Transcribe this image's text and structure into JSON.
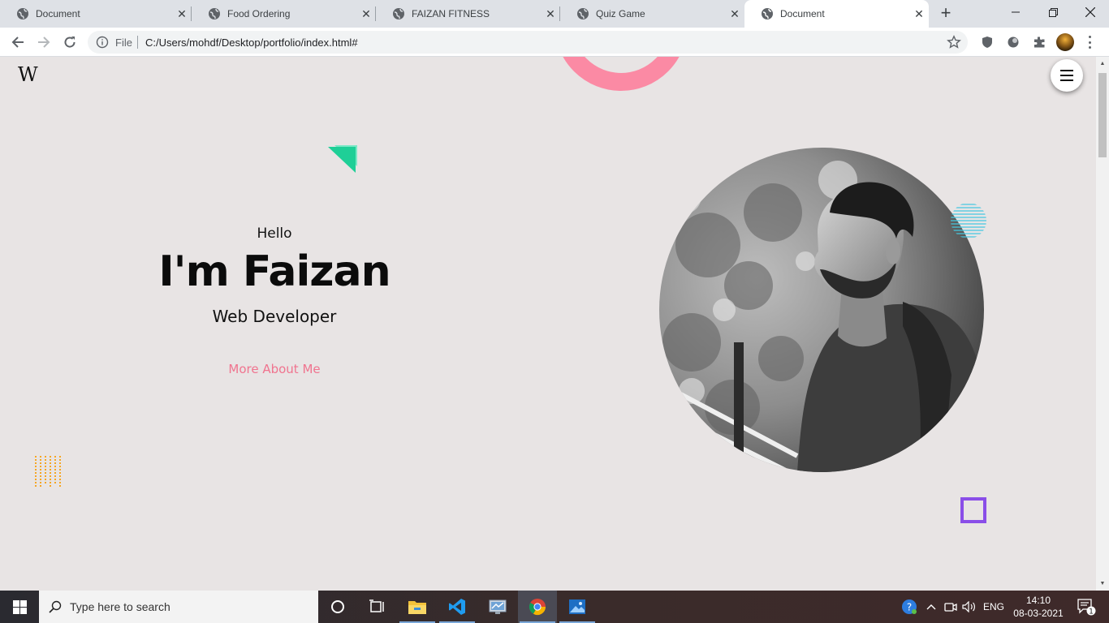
{
  "browser": {
    "tabs": [
      {
        "label": "Document",
        "active": false
      },
      {
        "label": "Food Ordering",
        "active": false
      },
      {
        "label": "FAIZAN FITNESS",
        "active": false
      },
      {
        "label": "Quiz Game",
        "active": false
      },
      {
        "label": "Document",
        "active": true
      }
    ],
    "new_tab_icon": "plus-icon",
    "window_controls": [
      "minimize-icon",
      "restore-icon",
      "close-icon"
    ],
    "nav": {
      "back_icon": "back-arrow-icon",
      "forward_icon": "forward-arrow-icon",
      "reload_icon": "reload-icon"
    },
    "address": {
      "scheme_label": "File",
      "url": "C:/Users/mohdf/Desktop/portfolio/index.html#"
    },
    "extensions": [
      "shield-icon",
      "circle-extension-icon",
      "puzzle-icon"
    ],
    "menu_icon": "kebab-menu-icon"
  },
  "page": {
    "logo": "W",
    "menu_icon": "hamburger-icon",
    "greeting": "Hello",
    "name": "I'm Faizan",
    "role": "Web Developer",
    "cta": "More About Me",
    "colors": {
      "background": "#e8e4e4",
      "accent_pink": "#fb8aa4",
      "accent_green": "#2ed39d",
      "accent_purple": "#8a4ee8",
      "accent_orange": "#f5a623",
      "accent_cyan": "#45c8e0",
      "cta_text": "#f0748f"
    }
  },
  "taskbar": {
    "search_placeholder": "Type here to search",
    "apps": [
      "cortana-icon",
      "task-view-icon",
      "file-explorer-icon",
      "vscode-icon",
      "control-panel-icon",
      "chrome-icon",
      "photos-icon"
    ],
    "language": "ENG",
    "time": "14:10",
    "date": "08-03-2021",
    "notification_count": "1"
  }
}
